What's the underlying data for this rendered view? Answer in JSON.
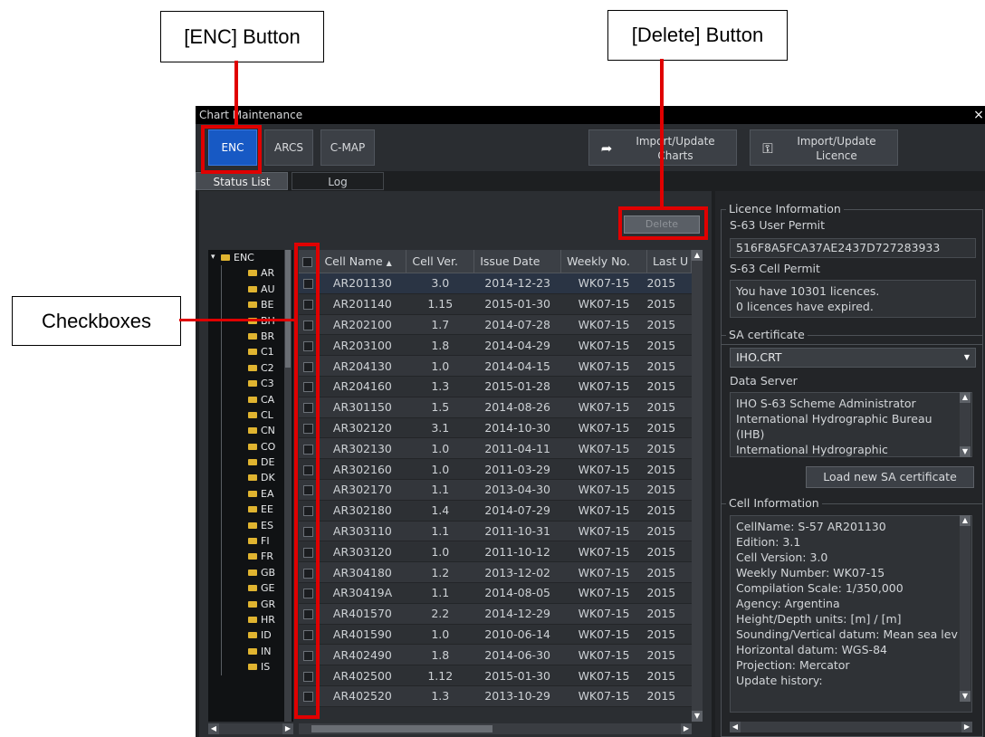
{
  "callouts": {
    "enc": "[ENC] Button",
    "delete": "[Delete] Button",
    "checkboxes": "Checkboxes"
  },
  "window": {
    "title": "Chart Maintenance",
    "close": "×"
  },
  "toolbar": {
    "enc": "ENC",
    "arcs": "ARCS",
    "cmap": "C-MAP",
    "import_charts": "Import/Update\nCharts",
    "import_licence": "Import/Update\nLicence"
  },
  "tabs": {
    "status": "Status List",
    "log": "Log"
  },
  "delete_label": "Delete",
  "tree": {
    "root": "ENC",
    "folders": [
      "AR",
      "AU",
      "BE",
      "BH",
      "BR",
      "C1",
      "C2",
      "C3",
      "CA",
      "CL",
      "CN",
      "CO",
      "DE",
      "DK",
      "EA",
      "EE",
      "ES",
      "FI",
      "FR",
      "GB",
      "GE",
      "GR",
      "HR",
      "ID",
      "IN",
      "IS"
    ]
  },
  "grid": {
    "columns": [
      "",
      "Cell Name",
      "Cell Ver.",
      "Issue Date",
      "Weekly No.",
      "Last U"
    ],
    "rows": [
      [
        "AR201130",
        "3.0",
        "2014-12-23",
        "WK07-15",
        "2015"
      ],
      [
        "AR201140",
        "1.15",
        "2015-01-30",
        "WK07-15",
        "2015"
      ],
      [
        "AR202100",
        "1.7",
        "2014-07-28",
        "WK07-15",
        "2015"
      ],
      [
        "AR203100",
        "1.8",
        "2014-04-29",
        "WK07-15",
        "2015"
      ],
      [
        "AR204130",
        "1.0",
        "2014-04-15",
        "WK07-15",
        "2015"
      ],
      [
        "AR204160",
        "1.3",
        "2015-01-28",
        "WK07-15",
        "2015"
      ],
      [
        "AR301150",
        "1.5",
        "2014-08-26",
        "WK07-15",
        "2015"
      ],
      [
        "AR302120",
        "3.1",
        "2014-10-30",
        "WK07-15",
        "2015"
      ],
      [
        "AR302130",
        "1.0",
        "2011-04-11",
        "WK07-15",
        "2015"
      ],
      [
        "AR302160",
        "1.0",
        "2011-03-29",
        "WK07-15",
        "2015"
      ],
      [
        "AR302170",
        "1.1",
        "2013-04-30",
        "WK07-15",
        "2015"
      ],
      [
        "AR302180",
        "1.4",
        "2014-07-29",
        "WK07-15",
        "2015"
      ],
      [
        "AR303110",
        "1.1",
        "2011-10-31",
        "WK07-15",
        "2015"
      ],
      [
        "AR303120",
        "1.0",
        "2011-10-12",
        "WK07-15",
        "2015"
      ],
      [
        "AR304180",
        "1.2",
        "2013-12-02",
        "WK07-15",
        "2015"
      ],
      [
        "AR30419A",
        "1.1",
        "2014-08-05",
        "WK07-15",
        "2015"
      ],
      [
        "AR401570",
        "2.2",
        "2014-12-29",
        "WK07-15",
        "2015"
      ],
      [
        "AR401590",
        "1.0",
        "2010-06-14",
        "WK07-15",
        "2015"
      ],
      [
        "AR402490",
        "1.8",
        "2014-06-30",
        "WK07-15",
        "2015"
      ],
      [
        "AR402500",
        "1.12",
        "2015-01-30",
        "WK07-15",
        "2015"
      ],
      [
        "AR402520",
        "1.3",
        "2013-10-29",
        "WK07-15",
        "2015"
      ]
    ]
  },
  "licence": {
    "title": "Licence Information",
    "user_permit_label": "S-63 User Permit",
    "user_permit_value": "516F8A5FCA37AE2437D727283933",
    "cell_permit_label": "S-63 Cell Permit",
    "cell_permit_text": "You have 10301 licences.\n0 licences have expired."
  },
  "sa": {
    "title": "SA certificate",
    "selected": "IHO.CRT",
    "data_server_label": "Data Server",
    "data_server_text": "IHO S-63 Scheme Administrator\nInternational Hydrographic Bureau\n(IHB)\nInternational Hydrographic",
    "load_button": "Load new SA certificate"
  },
  "cell_info": {
    "title": "Cell Information",
    "text": "CellName: S-57 AR201130\nEdition: 3.1\nCell Version: 3.0\nWeekly Number: WK07-15\nCompilation Scale: 1/350,000\nAgency: Argentina\nHeight/Depth units: [m] / [m]\nSounding/Vertical datum: Mean sea lev\nHorizontal datum: WGS-84\nProjection: Mercator\nUpdate history:"
  },
  "colors": {
    "highlight_red": "#e00000",
    "active_tab_blue": "#1759c4"
  }
}
